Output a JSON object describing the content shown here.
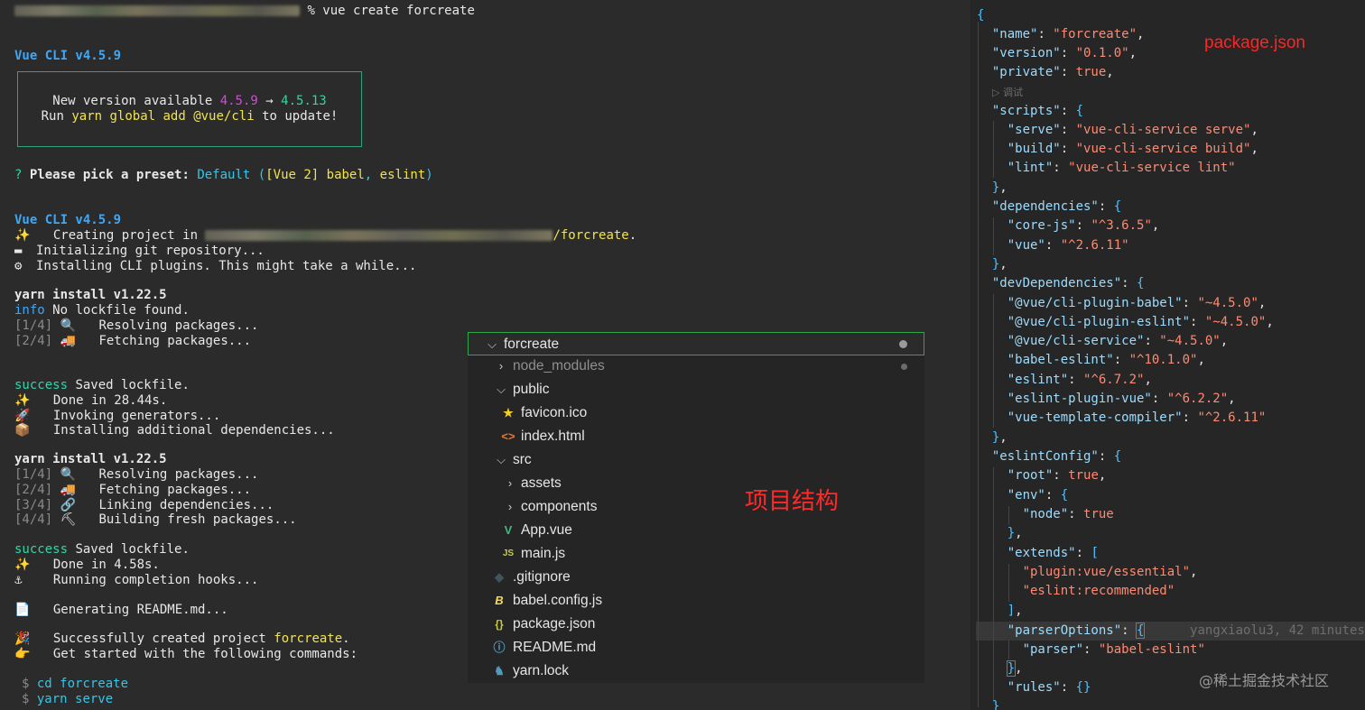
{
  "terminal": {
    "prompt_cmd": "% vue create forcreate",
    "cli_version_1": "Vue CLI v4.5.9",
    "update_box": {
      "line1_prefix": "New version available ",
      "old_version": "4.5.9",
      "arrow": " → ",
      "new_version": "4.5.13",
      "line2_prefix": "Run ",
      "command": "yarn global add @vue/cli",
      "line2_suffix": " to update!"
    },
    "preset": {
      "q": "?",
      "label": "Please pick a preset:",
      "choice": "Default",
      "open": "(",
      "detail": "[Vue 2] babel",
      "sep": ",",
      "detail2": "eslint",
      "close": ")"
    },
    "cli_version_2": "Vue CLI v4.5.9",
    "creating_prefix": "Creating project in ",
    "creating_suffix": "/forcreate",
    "creating_dot": ".",
    "init_git": "Initializing git repository...",
    "installing_plugins": "Installing CLI plugins. This might take a while...",
    "yarn_install_1": "yarn install v1.22.5",
    "info_tag": "info",
    "no_lockfile": "No lockfile found.",
    "step1_tag": "[1/4]",
    "step1_text": "Resolving packages...",
    "step2_tag": "[2/4]",
    "step2_text": "Fetching packages...",
    "success_tag": "success",
    "saved_lockfile": "Saved lockfile.",
    "done1": "Done in 28.44s.",
    "invoking": "Invoking generators...",
    "installing_deps": "Installing additional dependencies...",
    "yarn_install_2": "yarn install v1.22.5",
    "s1_tag": "[1/4]",
    "s1_text": "Resolving packages...",
    "s2_tag": "[2/4]",
    "s2_text": "Fetching packages...",
    "s3_tag": "[3/4]",
    "s3_text": "Linking dependencies...",
    "s4_tag": "[4/4]",
    "s4_text": "Building fresh packages...",
    "success_tag_2": "success",
    "saved_lockfile_2": "Saved lockfile.",
    "done2": "Done in 4.58s.",
    "hooks": "Running completion hooks...",
    "readme": "Generating README.md...",
    "created_prefix": "Successfully created project ",
    "created_name": "forcreate",
    "created_dot": ".",
    "get_started": "Get started with the following commands:",
    "dollar1": "$",
    "cmd1": "cd forcreate",
    "dollar2": "$",
    "cmd2": "yarn serve"
  },
  "json_panel": {
    "annotation": "package.json",
    "name_key": "\"name\"",
    "name_val": "\"forcreate\"",
    "version_key": "\"version\"",
    "version_val": "\"0.1.0\"",
    "private_key": "\"private\"",
    "private_val": "true",
    "debug_hint": "▷ 调试",
    "scripts_key": "\"scripts\"",
    "serve_key": "\"serve\"",
    "serve_val": "\"vue-cli-service serve\"",
    "build_key": "\"build\"",
    "build_val": "\"vue-cli-service build\"",
    "lint_key": "\"lint\"",
    "lint_val": "\"vue-cli-service lint\"",
    "deps_key": "\"dependencies\"",
    "corejs_key": "\"core-js\"",
    "corejs_val": "\"^3.6.5\"",
    "vue_key": "\"vue\"",
    "vue_val": "\"^2.6.11\"",
    "devdeps_key": "\"devDependencies\"",
    "pb_key": "\"@vue/cli-plugin-babel\"",
    "pb_val": "\"~4.5.0\"",
    "pe_key": "\"@vue/cli-plugin-eslint\"",
    "pe_val": "\"~4.5.0\"",
    "cs_key": "\"@vue/cli-service\"",
    "cs_val": "\"~4.5.0\"",
    "be_key": "\"babel-eslint\"",
    "be_val": "\"^10.1.0\"",
    "es_key": "\"eslint\"",
    "es_val": "\"^6.7.2\"",
    "epv_key": "\"eslint-plugin-vue\"",
    "epv_val": "\"^6.2.2\"",
    "vtc_key": "\"vue-template-compiler\"",
    "vtc_val": "\"^2.6.11\"",
    "eslintcfg_key": "\"eslintConfig\"",
    "root_key": "\"root\"",
    "root_val": "true",
    "env_key": "\"env\"",
    "node_key": "\"node\"",
    "node_val": "true",
    "extends_key": "\"extends\"",
    "ext1": "\"plugin:vue/essential\"",
    "ext2": "\"eslint:recommended\"",
    "parser_opts_key": "\"parserOptions\"",
    "blame": "yangxiaolu3, 42 minutes",
    "parser_key": "\"parser\"",
    "parser_val": "\"babel-eslint\"",
    "rules_key": "\"rules\"",
    "watermark": "@稀土掘金技术社区"
  },
  "explorer": {
    "annotation": "项目结构",
    "items": [
      {
        "name": "forcreate"
      },
      {
        "name": "node_modules"
      },
      {
        "name": "public"
      },
      {
        "name": "favicon.ico"
      },
      {
        "name": "index.html"
      },
      {
        "name": "src"
      },
      {
        "name": "assets"
      },
      {
        "name": "components"
      },
      {
        "name": "App.vue"
      },
      {
        "name": "main.js"
      },
      {
        "name": ".gitignore"
      },
      {
        "name": "babel.config.js"
      },
      {
        "name": "package.json"
      },
      {
        "name": "README.md"
      },
      {
        "name": "yarn.lock"
      }
    ]
  },
  "colors": {
    "accent_green": "#2ba84a",
    "annotation_red": "#ff2424",
    "vue_green": "#41b883"
  }
}
